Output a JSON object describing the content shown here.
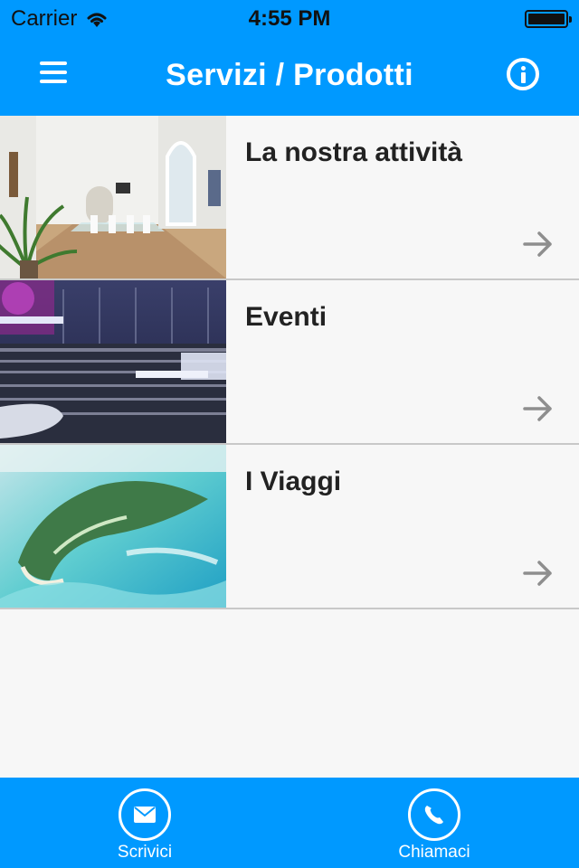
{
  "status": {
    "carrier": "Carrier",
    "time": "4:55 PM"
  },
  "nav": {
    "title": "Servizi / Prodotti",
    "menu_icon": "hamburger-menu-icon",
    "info_icon": "info-icon"
  },
  "items": [
    {
      "label": "La nostra attività",
      "image": "office-room-photo"
    },
    {
      "label": "Eventi",
      "image": "concert-crowd-photo"
    },
    {
      "label": "I Viaggi",
      "image": "tropical-island-photo"
    }
  ],
  "tabbar": {
    "write_label": "Scrivici",
    "call_label": "Chiamaci"
  },
  "colors": {
    "accent": "#0099ff",
    "background": "#f7f7f7",
    "divider": "#c8c8c8"
  }
}
